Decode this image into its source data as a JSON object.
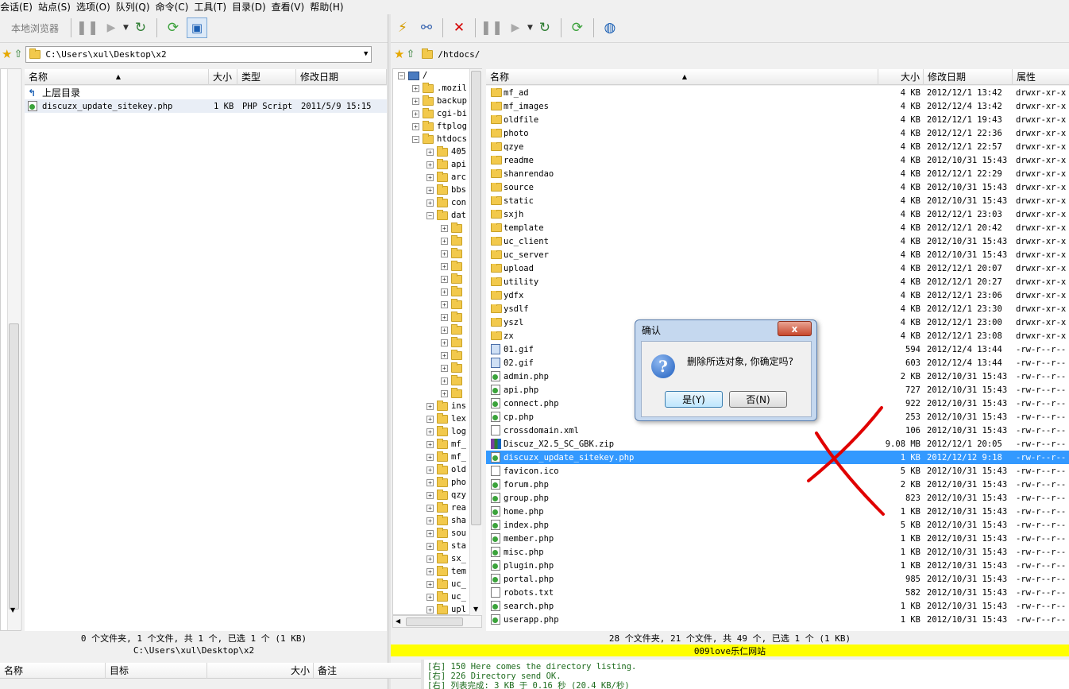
{
  "menu": [
    "会话(E)",
    "站点(S)",
    "选项(O)",
    "队列(Q)",
    "命令(C)",
    "工具(T)",
    "目录(D)",
    "查看(V)",
    "帮助(H)"
  ],
  "toolbar_left": {
    "local_browser": "本地浏览器"
  },
  "left_path": "C:\\Users\\xul\\Desktop\\x2",
  "right_path": "/htdocs/",
  "left_headers": {
    "name": "名称",
    "size": "大小",
    "type": "类型",
    "modified": "修改日期"
  },
  "left_files": [
    {
      "name": "上层目录",
      "size": "",
      "type": "",
      "modified": "",
      "icon": "up-folder-icon"
    },
    {
      "name": "discuzx_update_sitekey.php",
      "size": "1 KB",
      "type": "PHP Script",
      "modified": "2011/5/9 15:15",
      "icon": "php-file-icon"
    }
  ],
  "left_status": "0 个文件夹, 1 个文件, 共 1 个, 已选 1 个 (1 KB)",
  "left_status_path": "C:\\Users\\xul\\Desktop\\x2",
  "tree": [
    {
      "label": "/",
      "level": 0
    },
    {
      "label": ".mozil",
      "level": 1
    },
    {
      "label": "backup",
      "level": 1
    },
    {
      "label": "cgi-bi",
      "level": 1
    },
    {
      "label": "ftplog",
      "level": 1
    },
    {
      "label": "htdocs",
      "level": 1
    },
    {
      "label": "405",
      "level": 2
    },
    {
      "label": "api",
      "level": 2
    },
    {
      "label": "arc",
      "level": 2
    },
    {
      "label": "bbs",
      "level": 2
    },
    {
      "label": "con",
      "level": 2
    },
    {
      "label": "dat",
      "level": 2
    },
    {
      "label": "",
      "level": 3
    },
    {
      "label": "",
      "level": 3
    },
    {
      "label": "",
      "level": 3
    },
    {
      "label": "",
      "level": 3
    },
    {
      "label": "",
      "level": 3
    },
    {
      "label": "",
      "level": 3
    },
    {
      "label": "",
      "level": 3
    },
    {
      "label": "",
      "level": 3
    },
    {
      "label": "",
      "level": 3
    },
    {
      "label": "",
      "level": 3
    },
    {
      "label": "",
      "level": 3
    },
    {
      "label": "",
      "level": 3
    },
    {
      "label": "",
      "level": 3
    },
    {
      "label": "",
      "level": 3
    },
    {
      "label": "ins",
      "level": 2
    },
    {
      "label": "lex",
      "level": 2
    },
    {
      "label": "log",
      "level": 2
    },
    {
      "label": "mf_",
      "level": 2
    },
    {
      "label": "mf_",
      "level": 2
    },
    {
      "label": "old",
      "level": 2
    },
    {
      "label": "pho",
      "level": 2
    },
    {
      "label": "qzy",
      "level": 2
    },
    {
      "label": "rea",
      "level": 2
    },
    {
      "label": "sha",
      "level": 2
    },
    {
      "label": "sou",
      "level": 2
    },
    {
      "label": "sta",
      "level": 2
    },
    {
      "label": "sx_",
      "level": 2
    },
    {
      "label": "tem",
      "level": 2
    },
    {
      "label": "uc_",
      "level": 2
    },
    {
      "label": "uc_",
      "level": 2
    },
    {
      "label": "upl",
      "level": 2
    }
  ],
  "right_headers": {
    "name": "名称",
    "size": "大小",
    "modified": "修改日期",
    "attr": "属性"
  },
  "right_files": [
    {
      "name": "mf_ad",
      "size": "4 KB",
      "modified": "2012/12/1 13:42",
      "attr": "drwxr-xr-x",
      "icon": "folder"
    },
    {
      "name": "mf_images",
      "size": "4 KB",
      "modified": "2012/12/4 13:42",
      "attr": "drwxr-xr-x",
      "icon": "folder"
    },
    {
      "name": "oldfile",
      "size": "4 KB",
      "modified": "2012/12/1 19:43",
      "attr": "drwxr-xr-x",
      "icon": "folder"
    },
    {
      "name": "photo",
      "size": "4 KB",
      "modified": "2012/12/1 22:36",
      "attr": "drwxr-xr-x",
      "icon": "folder"
    },
    {
      "name": "qzye",
      "size": "4 KB",
      "modified": "2012/12/1 22:57",
      "attr": "drwxr-xr-x",
      "icon": "folder"
    },
    {
      "name": "readme",
      "size": "4 KB",
      "modified": "2012/10/31 15:43",
      "attr": "drwxr-xr-x",
      "icon": "folder"
    },
    {
      "name": "shanrendao",
      "size": "4 KB",
      "modified": "2012/12/1 22:29",
      "attr": "drwxr-xr-x",
      "icon": "folder"
    },
    {
      "name": "source",
      "size": "4 KB",
      "modified": "2012/10/31 15:43",
      "attr": "drwxr-xr-x",
      "icon": "folder"
    },
    {
      "name": "static",
      "size": "4 KB",
      "modified": "2012/10/31 15:43",
      "attr": "drwxr-xr-x",
      "icon": "folder"
    },
    {
      "name": "sxjh",
      "size": "4 KB",
      "modified": "2012/12/1 23:03",
      "attr": "drwxr-xr-x",
      "icon": "folder"
    },
    {
      "name": "template",
      "size": "4 KB",
      "modified": "2012/12/1 20:42",
      "attr": "drwxr-xr-x",
      "icon": "folder"
    },
    {
      "name": "uc_client",
      "size": "4 KB",
      "modified": "2012/10/31 15:43",
      "attr": "drwxr-xr-x",
      "icon": "folder"
    },
    {
      "name": "uc_server",
      "size": "4 KB",
      "modified": "2012/10/31 15:43",
      "attr": "drwxr-xr-x",
      "icon": "folder"
    },
    {
      "name": "upload",
      "size": "4 KB",
      "modified": "2012/12/1 20:07",
      "attr": "drwxr-xr-x",
      "icon": "folder"
    },
    {
      "name": "utility",
      "size": "4 KB",
      "modified": "2012/12/1 20:27",
      "attr": "drwxr-xr-x",
      "icon": "folder"
    },
    {
      "name": "ydfx",
      "size": "4 KB",
      "modified": "2012/12/1 23:06",
      "attr": "drwxr-xr-x",
      "icon": "folder"
    },
    {
      "name": "ysdlf",
      "size": "4 KB",
      "modified": "2012/12/1 23:30",
      "attr": "drwxr-xr-x",
      "icon": "folder"
    },
    {
      "name": "yszl",
      "size": "4 KB",
      "modified": "2012/12/1 23:00",
      "attr": "drwxr-xr-x",
      "icon": "folder"
    },
    {
      "name": "zx",
      "size": "4 KB",
      "modified": "2012/12/1 23:08",
      "attr": "drwxr-xr-x",
      "icon": "folder"
    },
    {
      "name": "01.gif",
      "size": "594",
      "modified": "2012/12/4 13:44",
      "attr": "-rw-r--r--",
      "icon": "image"
    },
    {
      "name": "02.gif",
      "size": "603",
      "modified": "2012/12/4 13:44",
      "attr": "-rw-r--r--",
      "icon": "image"
    },
    {
      "name": "admin.php",
      "size": "2 KB",
      "modified": "2012/10/31 15:43",
      "attr": "-rw-r--r--",
      "icon": "php"
    },
    {
      "name": "api.php",
      "size": "727",
      "modified": "2012/10/31 15:43",
      "attr": "-rw-r--r--",
      "icon": "php"
    },
    {
      "name": "connect.php",
      "size": "922",
      "modified": "2012/10/31 15:43",
      "attr": "-rw-r--r--",
      "icon": "php"
    },
    {
      "name": "cp.php",
      "size": "253",
      "modified": "2012/10/31 15:43",
      "attr": "-rw-r--r--",
      "icon": "php"
    },
    {
      "name": "crossdomain.xml",
      "size": "106",
      "modified": "2012/10/31 15:43",
      "attr": "-rw-r--r--",
      "icon": "file"
    },
    {
      "name": "Discuz_X2.5_SC_GBK.zip",
      "size": "9.08 MB",
      "modified": "2012/12/1 20:05",
      "attr": "-rw-r--r--",
      "icon": "zip"
    },
    {
      "name": "discuzx_update_sitekey.php",
      "size": "1 KB",
      "modified": "2012/12/12 9:18",
      "attr": "-rw-r--r--",
      "icon": "php",
      "selected": true
    },
    {
      "name": "favicon.ico",
      "size": "5 KB",
      "modified": "2012/10/31 15:43",
      "attr": "-rw-r--r--",
      "icon": "file"
    },
    {
      "name": "forum.php",
      "size": "2 KB",
      "modified": "2012/10/31 15:43",
      "attr": "-rw-r--r--",
      "icon": "php"
    },
    {
      "name": "group.php",
      "size": "823",
      "modified": "2012/10/31 15:43",
      "attr": "-rw-r--r--",
      "icon": "php"
    },
    {
      "name": "home.php",
      "size": "1 KB",
      "modified": "2012/10/31 15:43",
      "attr": "-rw-r--r--",
      "icon": "php"
    },
    {
      "name": "index.php",
      "size": "5 KB",
      "modified": "2012/10/31 15:43",
      "attr": "-rw-r--r--",
      "icon": "php"
    },
    {
      "name": "member.php",
      "size": "1 KB",
      "modified": "2012/10/31 15:43",
      "attr": "-rw-r--r--",
      "icon": "php"
    },
    {
      "name": "misc.php",
      "size": "1 KB",
      "modified": "2012/10/31 15:43",
      "attr": "-rw-r--r--",
      "icon": "php"
    },
    {
      "name": "plugin.php",
      "size": "1 KB",
      "modified": "2012/10/31 15:43",
      "attr": "-rw-r--r--",
      "icon": "php"
    },
    {
      "name": "portal.php",
      "size": "985",
      "modified": "2012/10/31 15:43",
      "attr": "-rw-r--r--",
      "icon": "php"
    },
    {
      "name": "robots.txt",
      "size": "582",
      "modified": "2012/10/31 15:43",
      "attr": "-rw-r--r--",
      "icon": "file"
    },
    {
      "name": "search.php",
      "size": "1 KB",
      "modified": "2012/10/31 15:43",
      "attr": "-rw-r--r--",
      "icon": "php"
    },
    {
      "name": "userapp.php",
      "size": "1 KB",
      "modified": "2012/10/31 15:43",
      "attr": "-rw-r--r--",
      "icon": "php"
    }
  ],
  "right_status": "28 个文件夹, 21 个文件, 共 49 个, 已选 1 个 (1 KB)",
  "right_site_label": "009love乐仁网站",
  "queue_headers": {
    "name": "名称",
    "target": "目标",
    "size": "大小",
    "note": "备注"
  },
  "log": [
    "[右] 150 Here comes the directory listing.",
    "[右] 226 Directory send OK.",
    "[右] 列表完成: 3 KB 于 0.16 秒 (20.4 KB/秒)"
  ],
  "dialog": {
    "title": "确认",
    "message": "删除所选对象, 你确定吗?",
    "yes": "是(Y)",
    "no": "否(N)",
    "close": "x"
  },
  "colors": {
    "selection": "#3399ff",
    "site_bar": "#ffff00",
    "annotation": "#e00000"
  }
}
